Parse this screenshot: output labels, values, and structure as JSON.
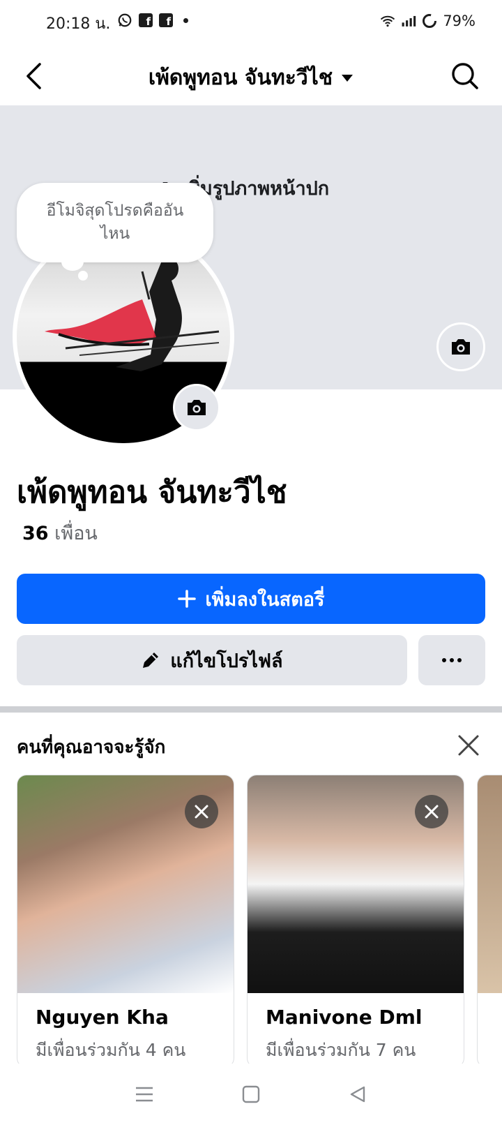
{
  "status_bar": {
    "time": "20:18 น.",
    "battery": "79%"
  },
  "header": {
    "title": "เพ้ดพูทอน จันทะวีไช"
  },
  "cover": {
    "add_cover_label": "เพิ่มรูปภาพหน้าปก"
  },
  "avatar_bubble": {
    "text": "อีโมจิสุดโปรดคืออันไหน"
  },
  "profile": {
    "name": "เพ้ดพูทอน จันทะวีไช",
    "friends_number": "36",
    "friends_label": "เพื่อน"
  },
  "actions": {
    "add_story": "เพิ่มลงในสตอรี่",
    "edit_profile": "แก้ไขโปรไฟล์"
  },
  "pymk": {
    "title": "คนที่คุณอาจจะรู้จัก",
    "cards": [
      {
        "name": "Nguyen Kha",
        "mutual": "มีเพื่อนร่วมกัน 4 คน"
      },
      {
        "name": "Manivone Dml",
        "mutual": "มีเพื่อนร่วมกัน 7 คน"
      }
    ]
  },
  "icons": {
    "back": "chevron-left-icon",
    "search": "search-icon",
    "camera": "camera-icon",
    "plus": "plus-icon",
    "pencil": "pencil-icon",
    "more": "more-icon",
    "close": "close-icon"
  },
  "colors": {
    "primary": "#0866ff",
    "secondary_bg": "#e4e6eb",
    "muted_text": "#65676b"
  }
}
